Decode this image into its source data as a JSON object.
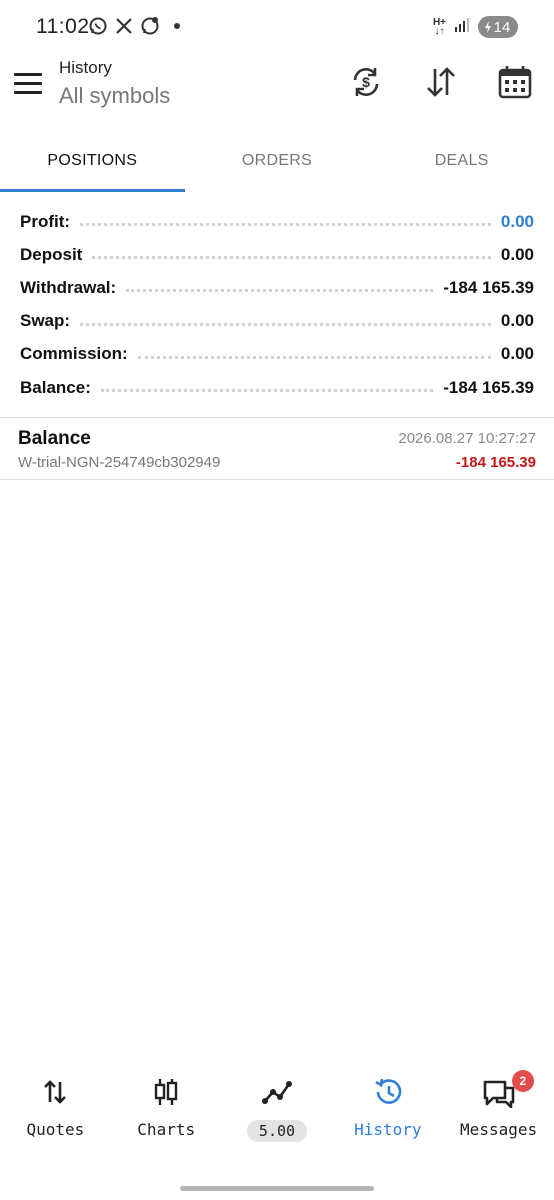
{
  "status_bar": {
    "time": "11:02",
    "left_icons": [
      "whatsapp-icon",
      "x-icon",
      "whatsapp-business-icon"
    ],
    "battery": "14"
  },
  "app_bar": {
    "title": "History",
    "subtitle": "All symbols",
    "actions": [
      "currency-exchange-icon",
      "sort-icon",
      "calendar-icon"
    ]
  },
  "tabs": [
    {
      "label": "POSITIONS",
      "active": true
    },
    {
      "label": "ORDERS",
      "active": false
    },
    {
      "label": "DEALS",
      "active": false
    }
  ],
  "summary": [
    {
      "label": "Profit:",
      "value": "0.00",
      "highlight": true
    },
    {
      "label": "Deposit",
      "value": "0.00"
    },
    {
      "label": "Withdrawal:",
      "value": "-184 165.39"
    },
    {
      "label": "Swap:",
      "value": "0.00"
    },
    {
      "label": "Commission:",
      "value": "0.00"
    },
    {
      "label": "Balance:",
      "value": "-184 165.39"
    }
  ],
  "deals": [
    {
      "name": "Balance",
      "id": "W-trial-NGN-254749cb302949",
      "time": "2026.08.27 10:27:27",
      "amount": "-184 165.39"
    }
  ],
  "bottom_nav": [
    {
      "label": "Quotes",
      "icon": "quotes-arrows-icon"
    },
    {
      "label": "Charts",
      "icon": "candlestick-icon"
    },
    {
      "label": "5.00",
      "icon": "trade-line-icon",
      "pill": true
    },
    {
      "label": "History",
      "icon": "history-clock-icon",
      "active": true
    },
    {
      "label": "Messages",
      "icon": "messages-icon",
      "badge": "2"
    }
  ],
  "colors": {
    "accent": "#2f7fd4",
    "negative": "#c21818",
    "badge": "#e34c4c"
  }
}
